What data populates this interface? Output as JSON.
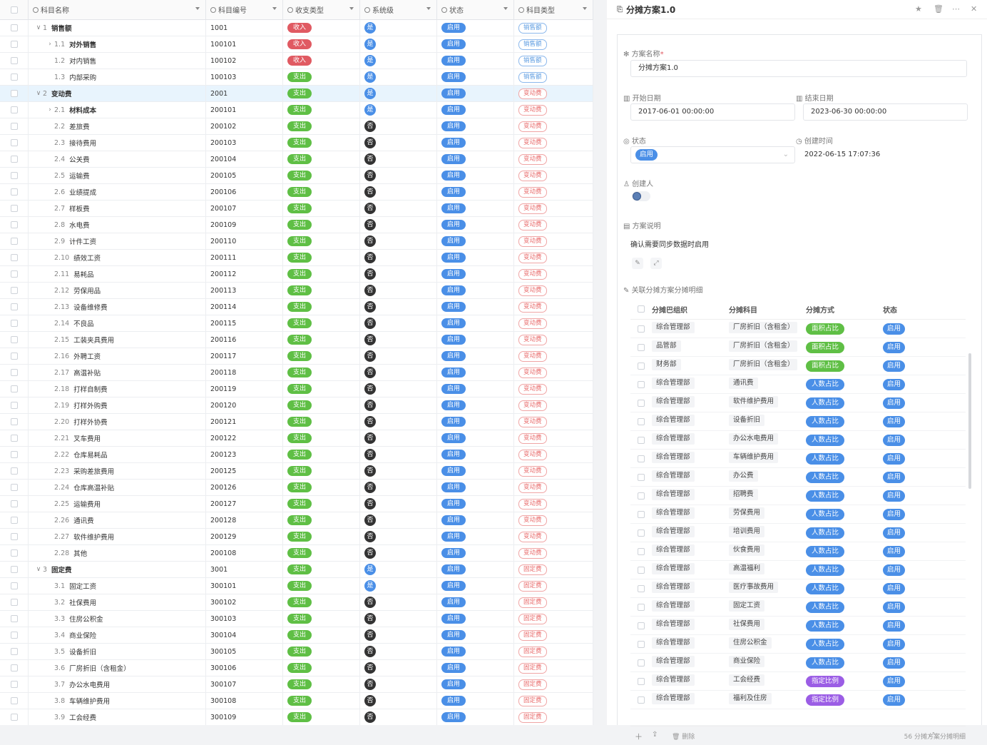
{
  "left_table": {
    "columns": [
      "科目名称",
      "科目编号",
      "收支类型",
      "系统级",
      "状态",
      "科目类型"
    ],
    "rows": [
      {
        "lvl": 0,
        "tw": "∨",
        "code": "1",
        "name": "销售额",
        "bold": true,
        "num": "1001",
        "io": "收入",
        "sys": "是",
        "st": "启用",
        "type": "销售额"
      },
      {
        "lvl": 1,
        "tw": "›",
        "code": "1.1",
        "name": "对外销售",
        "bold": true,
        "num": "100101",
        "io": "收入",
        "sys": "是",
        "st": "启用",
        "type": "销售额"
      },
      {
        "lvl": 1,
        "tw": "",
        "code": "1.2",
        "name": "对内销售",
        "bold": false,
        "num": "100102",
        "io": "收入",
        "sys": "是",
        "st": "启用",
        "type": "销售额"
      },
      {
        "lvl": 1,
        "tw": "",
        "code": "1.3",
        "name": "内部采购",
        "bold": false,
        "num": "100103",
        "io": "支出",
        "sys": "是",
        "st": "启用",
        "type": "销售额"
      },
      {
        "lvl": 0,
        "tw": "∨",
        "code": "2",
        "name": "变动费",
        "bold": true,
        "num": "2001",
        "io": "支出",
        "sys": "是",
        "st": "启用",
        "type": "变动费",
        "hl": true
      },
      {
        "lvl": 1,
        "tw": "›",
        "code": "2.1",
        "name": "材料成本",
        "bold": true,
        "num": "200101",
        "io": "支出",
        "sys": "是",
        "st": "启用",
        "type": "变动费"
      },
      {
        "lvl": 1,
        "tw": "",
        "code": "2.2",
        "name": "差旅费",
        "bold": false,
        "num": "200102",
        "io": "支出",
        "sys": "否",
        "st": "启用",
        "type": "变动费"
      },
      {
        "lvl": 1,
        "tw": "",
        "code": "2.3",
        "name": "接待费用",
        "bold": false,
        "num": "200103",
        "io": "支出",
        "sys": "否",
        "st": "启用",
        "type": "变动费"
      },
      {
        "lvl": 1,
        "tw": "",
        "code": "2.4",
        "name": "公关费",
        "bold": false,
        "num": "200104",
        "io": "支出",
        "sys": "否",
        "st": "启用",
        "type": "变动费"
      },
      {
        "lvl": 1,
        "tw": "",
        "code": "2.5",
        "name": "运输费",
        "bold": false,
        "num": "200105",
        "io": "支出",
        "sys": "否",
        "st": "启用",
        "type": "变动费"
      },
      {
        "lvl": 1,
        "tw": "",
        "code": "2.6",
        "name": "业绩提成",
        "bold": false,
        "num": "200106",
        "io": "支出",
        "sys": "否",
        "st": "启用",
        "type": "变动费"
      },
      {
        "lvl": 1,
        "tw": "",
        "code": "2.7",
        "name": "样板费",
        "bold": false,
        "num": "200107",
        "io": "支出",
        "sys": "否",
        "st": "启用",
        "type": "变动费"
      },
      {
        "lvl": 1,
        "tw": "",
        "code": "2.8",
        "name": "水电费",
        "bold": false,
        "num": "200109",
        "io": "支出",
        "sys": "否",
        "st": "启用",
        "type": "变动费"
      },
      {
        "lvl": 1,
        "tw": "",
        "code": "2.9",
        "name": "计件工资",
        "bold": false,
        "num": "200110",
        "io": "支出",
        "sys": "否",
        "st": "启用",
        "type": "变动费"
      },
      {
        "lvl": 1,
        "tw": "",
        "code": "2.10",
        "name": "绩效工资",
        "bold": false,
        "num": "200111",
        "io": "支出",
        "sys": "否",
        "st": "启用",
        "type": "变动费"
      },
      {
        "lvl": 1,
        "tw": "",
        "code": "2.11",
        "name": "易耗品",
        "bold": false,
        "num": "200112",
        "io": "支出",
        "sys": "否",
        "st": "启用",
        "type": "变动费"
      },
      {
        "lvl": 1,
        "tw": "",
        "code": "2.12",
        "name": "劳保用品",
        "bold": false,
        "num": "200113",
        "io": "支出",
        "sys": "否",
        "st": "启用",
        "type": "变动费"
      },
      {
        "lvl": 1,
        "tw": "",
        "code": "2.13",
        "name": "设备维修费",
        "bold": false,
        "num": "200114",
        "io": "支出",
        "sys": "否",
        "st": "启用",
        "type": "变动费"
      },
      {
        "lvl": 1,
        "tw": "",
        "code": "2.14",
        "name": "不良品",
        "bold": false,
        "num": "200115",
        "io": "支出",
        "sys": "否",
        "st": "启用",
        "type": "变动费"
      },
      {
        "lvl": 1,
        "tw": "",
        "code": "2.15",
        "name": "工装夹具费用",
        "bold": false,
        "num": "200116",
        "io": "支出",
        "sys": "否",
        "st": "启用",
        "type": "变动费"
      },
      {
        "lvl": 1,
        "tw": "",
        "code": "2.16",
        "name": "外聘工资",
        "bold": false,
        "num": "200117",
        "io": "支出",
        "sys": "否",
        "st": "启用",
        "type": "变动费"
      },
      {
        "lvl": 1,
        "tw": "",
        "code": "2.17",
        "name": "高温补贴",
        "bold": false,
        "num": "200118",
        "io": "支出",
        "sys": "否",
        "st": "启用",
        "type": "变动费"
      },
      {
        "lvl": 1,
        "tw": "",
        "code": "2.18",
        "name": "打样自制费",
        "bold": false,
        "num": "200119",
        "io": "支出",
        "sys": "否",
        "st": "启用",
        "type": "变动费"
      },
      {
        "lvl": 1,
        "tw": "",
        "code": "2.19",
        "name": "打样外购费",
        "bold": false,
        "num": "200120",
        "io": "支出",
        "sys": "否",
        "st": "启用",
        "type": "变动费"
      },
      {
        "lvl": 1,
        "tw": "",
        "code": "2.20",
        "name": "打样外协费",
        "bold": false,
        "num": "200121",
        "io": "支出",
        "sys": "否",
        "st": "启用",
        "type": "变动费"
      },
      {
        "lvl": 1,
        "tw": "",
        "code": "2.21",
        "name": "叉车费用",
        "bold": false,
        "num": "200122",
        "io": "支出",
        "sys": "否",
        "st": "启用",
        "type": "变动费"
      },
      {
        "lvl": 1,
        "tw": "",
        "code": "2.22",
        "name": "仓库易耗品",
        "bold": false,
        "num": "200123",
        "io": "支出",
        "sys": "否",
        "st": "启用",
        "type": "变动费"
      },
      {
        "lvl": 1,
        "tw": "",
        "code": "2.23",
        "name": "采购差旅费用",
        "bold": false,
        "num": "200125",
        "io": "支出",
        "sys": "否",
        "st": "启用",
        "type": "变动费"
      },
      {
        "lvl": 1,
        "tw": "",
        "code": "2.24",
        "name": "仓库高温补贴",
        "bold": false,
        "num": "200126",
        "io": "支出",
        "sys": "否",
        "st": "启用",
        "type": "变动费"
      },
      {
        "lvl": 1,
        "tw": "",
        "code": "2.25",
        "name": "运输费用",
        "bold": false,
        "num": "200127",
        "io": "支出",
        "sys": "否",
        "st": "启用",
        "type": "变动费"
      },
      {
        "lvl": 1,
        "tw": "",
        "code": "2.26",
        "name": "通讯费",
        "bold": false,
        "num": "200128",
        "io": "支出",
        "sys": "否",
        "st": "启用",
        "type": "变动费"
      },
      {
        "lvl": 1,
        "tw": "",
        "code": "2.27",
        "name": "软件维护费用",
        "bold": false,
        "num": "200129",
        "io": "支出",
        "sys": "否",
        "st": "启用",
        "type": "变动费"
      },
      {
        "lvl": 1,
        "tw": "",
        "code": "2.28",
        "name": "其他",
        "bold": false,
        "num": "200108",
        "io": "支出",
        "sys": "否",
        "st": "启用",
        "type": "变动费"
      },
      {
        "lvl": 0,
        "tw": "∨",
        "code": "3",
        "name": "固定费",
        "bold": true,
        "num": "3001",
        "io": "支出",
        "sys": "是",
        "st": "启用",
        "type": "固定费"
      },
      {
        "lvl": 1,
        "tw": "",
        "code": "3.1",
        "name": "固定工资",
        "bold": false,
        "num": "300101",
        "io": "支出",
        "sys": "是",
        "st": "启用",
        "type": "固定费"
      },
      {
        "lvl": 1,
        "tw": "",
        "code": "3.2",
        "name": "社保费用",
        "bold": false,
        "num": "300102",
        "io": "支出",
        "sys": "否",
        "st": "启用",
        "type": "固定费"
      },
      {
        "lvl": 1,
        "tw": "",
        "code": "3.3",
        "name": "住房公积金",
        "bold": false,
        "num": "300103",
        "io": "支出",
        "sys": "否",
        "st": "启用",
        "type": "固定费"
      },
      {
        "lvl": 1,
        "tw": "",
        "code": "3.4",
        "name": "商业保险",
        "bold": false,
        "num": "300104",
        "io": "支出",
        "sys": "否",
        "st": "启用",
        "type": "固定费"
      },
      {
        "lvl": 1,
        "tw": "",
        "code": "3.5",
        "name": "设备折旧",
        "bold": false,
        "num": "300105",
        "io": "支出",
        "sys": "否",
        "st": "启用",
        "type": "固定费"
      },
      {
        "lvl": 1,
        "tw": "",
        "code": "3.6",
        "name": "厂房折旧（含租金）",
        "bold": false,
        "num": "300106",
        "io": "支出",
        "sys": "否",
        "st": "启用",
        "type": "固定费"
      },
      {
        "lvl": 1,
        "tw": "",
        "code": "3.7",
        "name": "办公水电费用",
        "bold": false,
        "num": "300107",
        "io": "支出",
        "sys": "否",
        "st": "启用",
        "type": "固定费"
      },
      {
        "lvl": 1,
        "tw": "",
        "code": "3.8",
        "name": "车辆维护费用",
        "bold": false,
        "num": "300108",
        "io": "支出",
        "sys": "否",
        "st": "启用",
        "type": "固定费"
      },
      {
        "lvl": 1,
        "tw": "",
        "code": "3.9",
        "name": "工会经费",
        "bold": false,
        "num": "300109",
        "io": "支出",
        "sys": "否",
        "st": "启用",
        "type": "固定费"
      }
    ]
  },
  "detail": {
    "title": "分摊方案1.0",
    "name_label": "方案名称",
    "name_required": "*",
    "name_value": "分摊方案1.0",
    "start_label": "开始日期",
    "start_value": "2017-06-01 00:00:00",
    "end_label": "结束日期",
    "end_value": "2023-06-30 00:00:00",
    "status_label": "状态",
    "status_value": "启用",
    "created_label": "创建时间",
    "created_value": "2022-06-15 17:07:36",
    "creator_label": "创建人",
    "desc_label": "方案说明",
    "desc_value": "确认需要同步数据时启用",
    "sub_label": "关联分摊方案分摊明细",
    "sub_columns": [
      "分摊巴组织",
      "分摊科目",
      "分摊方式",
      "状态"
    ],
    "sub_rows": [
      {
        "org": "综合管理部",
        "acct": "厂房折旧（含租金）",
        "m": "面积占比",
        "mt": "area",
        "st": "启用"
      },
      {
        "org": "品管部",
        "acct": "厂房折旧（含租金）",
        "m": "面积占比",
        "mt": "area",
        "st": "启用"
      },
      {
        "org": "财务部",
        "acct": "厂房折旧（含租金）",
        "m": "面积占比",
        "mt": "area",
        "st": "启用"
      },
      {
        "org": "综合管理部",
        "acct": "通讯费",
        "m": "人数占比",
        "mt": "people",
        "st": "启用"
      },
      {
        "org": "综合管理部",
        "acct": "软件维护费用",
        "m": "人数占比",
        "mt": "people",
        "st": "启用"
      },
      {
        "org": "综合管理部",
        "acct": "设备折旧",
        "m": "人数占比",
        "mt": "people",
        "st": "启用"
      },
      {
        "org": "综合管理部",
        "acct": "办公水电费用",
        "m": "人数占比",
        "mt": "people",
        "st": "启用"
      },
      {
        "org": "综合管理部",
        "acct": "车辆维护费用",
        "m": "人数占比",
        "mt": "people",
        "st": "启用"
      },
      {
        "org": "综合管理部",
        "acct": "办公费",
        "m": "人数占比",
        "mt": "people",
        "st": "启用"
      },
      {
        "org": "综合管理部",
        "acct": "招聘费",
        "m": "人数占比",
        "mt": "people",
        "st": "启用"
      },
      {
        "org": "综合管理部",
        "acct": "劳保费用",
        "m": "人数占比",
        "mt": "people",
        "st": "启用"
      },
      {
        "org": "综合管理部",
        "acct": "培训费用",
        "m": "人数占比",
        "mt": "people",
        "st": "启用"
      },
      {
        "org": "综合管理部",
        "acct": "伙食费用",
        "m": "人数占比",
        "mt": "people",
        "st": "启用"
      },
      {
        "org": "综合管理部",
        "acct": "高温福利",
        "m": "人数占比",
        "mt": "people",
        "st": "启用"
      },
      {
        "org": "综合管理部",
        "acct": "医疗事故费用",
        "m": "人数占比",
        "mt": "people",
        "st": "启用"
      },
      {
        "org": "综合管理部",
        "acct": "固定工资",
        "m": "人数占比",
        "mt": "people",
        "st": "启用"
      },
      {
        "org": "综合管理部",
        "acct": "社保费用",
        "m": "人数占比",
        "mt": "people",
        "st": "启用"
      },
      {
        "org": "综合管理部",
        "acct": "住房公积金",
        "m": "人数占比",
        "mt": "people",
        "st": "启用"
      },
      {
        "org": "综合管理部",
        "acct": "商业保险",
        "m": "人数占比",
        "mt": "people",
        "st": "启用"
      },
      {
        "org": "综合管理部",
        "acct": "工会经费",
        "m": "指定比例",
        "mt": "ratio",
        "st": "启用"
      },
      {
        "org": "综合管理部",
        "acct": "福利及住房",
        "m": "指定比例",
        "mt": "ratio",
        "st": "启用"
      }
    ],
    "delete_label": "删除",
    "count_label": "56 分摊方案分摊明细"
  }
}
